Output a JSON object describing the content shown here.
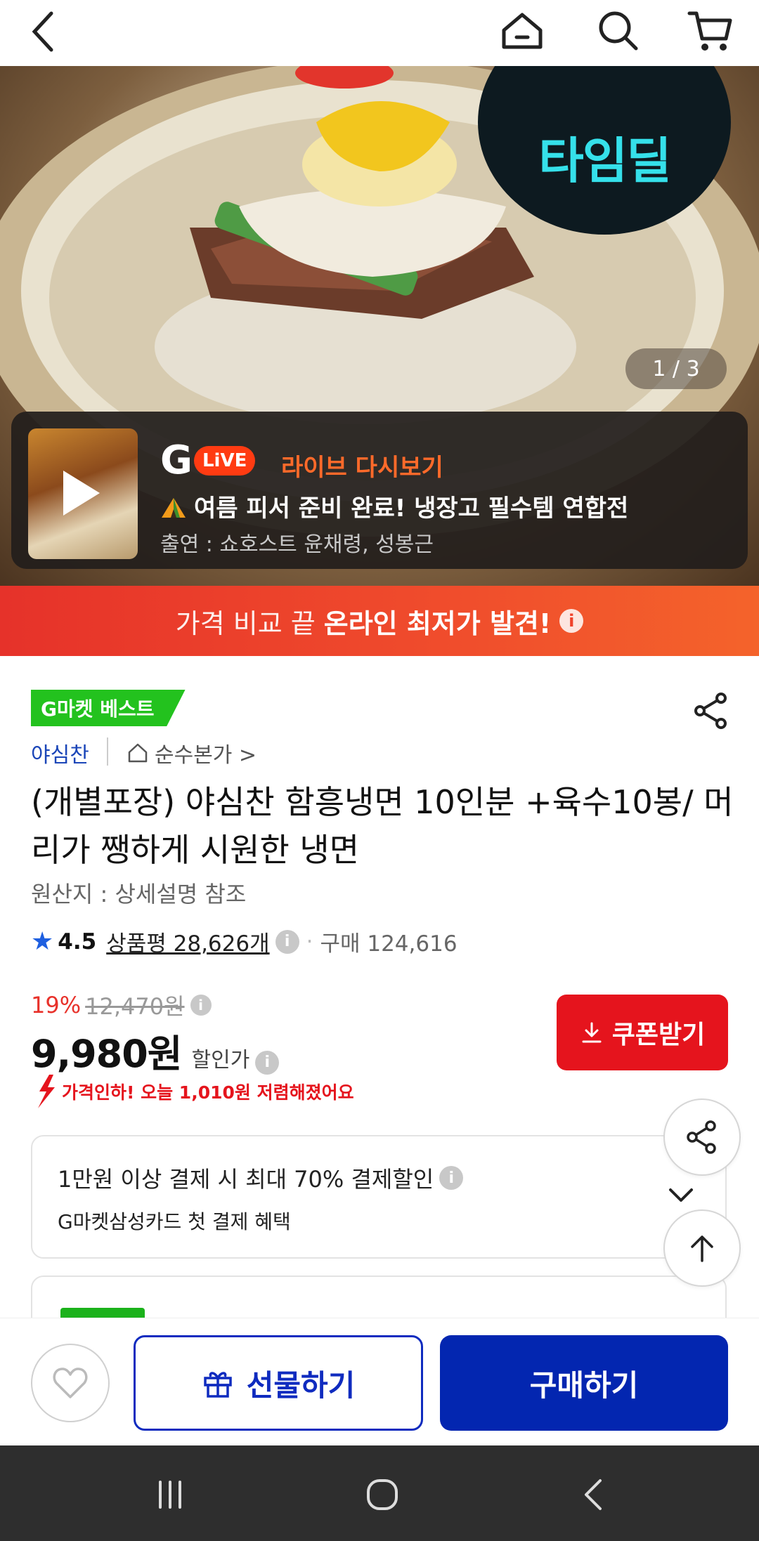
{
  "topbar": {
    "back": "back-icon",
    "home": "home-icon",
    "search": "search-icon",
    "cart": "cart-icon"
  },
  "hero": {
    "badge_text": "타임딜",
    "pager": "1 / 3",
    "live": {
      "logo_g": "G",
      "logo_pill": "LiVE",
      "label": "라이브 다시보기",
      "title": "여름 피서 준비 완료! 냉장고 필수템 연합전",
      "host": "출연 : 쇼호스트 윤채령, 성봉근"
    }
  },
  "price_banner": {
    "normal": "가격 비교 끝",
    "bold": "온라인 최저가 발견!",
    "info": "i"
  },
  "product": {
    "best_badge": "G마켓 베스트",
    "seller": "야심찬",
    "brand_link": "순수본가 >",
    "title": "(개별포장) 야심찬 함흥냉면 10인분 +육수10봉/ 머리가 쨍하게 시원한 냉면",
    "origin": "원산지 : 상세설명 참조",
    "rating": "4.5",
    "reviews": "상품평 28,626개",
    "sold": "구매 124,616",
    "discount_pct": "19%",
    "original_price": "12,470원",
    "price": "9,980원",
    "price_label": "할인가",
    "coupon_label": "쿠폰받기",
    "price_drop": "가격인하! 오늘 1,010원 저렴해졌어요"
  },
  "benefit": {
    "line1": "1만원 이상 결제 시 최대  70% 결제할인",
    "line2": "G마켓삼성카드 첫 결제 혜택"
  },
  "actions": {
    "gift_label": "선물하기",
    "buy_label": "구매하기"
  },
  "colors": {
    "accent_blue": "#0326b0",
    "accent_red": "#e5141d",
    "best_green": "#23c21e",
    "banner_orange": "#f04d2c"
  }
}
